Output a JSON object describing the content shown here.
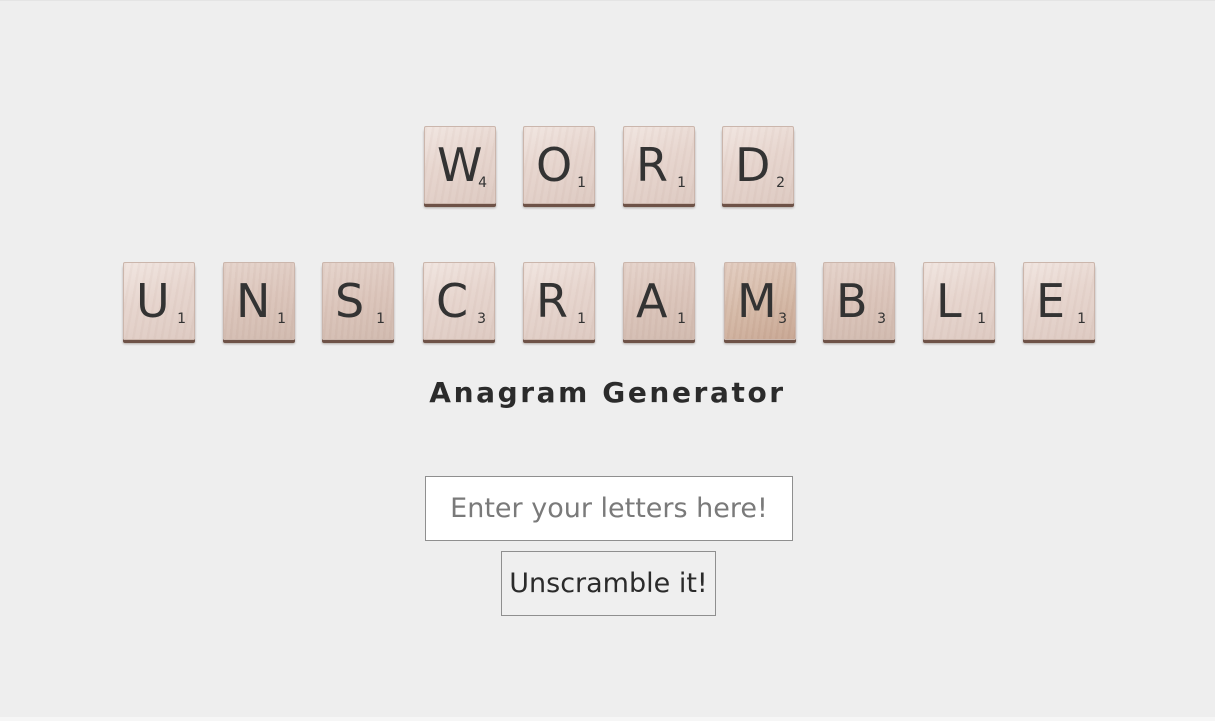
{
  "logo": {
    "row_word": {
      "tiles": [
        {
          "letter": "W",
          "score": "4"
        },
        {
          "letter": "O",
          "score": "1"
        },
        {
          "letter": "R",
          "score": "1"
        },
        {
          "letter": "D",
          "score": "2"
        }
      ]
    },
    "row_unscramble": {
      "tiles": [
        {
          "letter": "U",
          "score": "1"
        },
        {
          "letter": "N",
          "score": "1"
        },
        {
          "letter": "S",
          "score": "1"
        },
        {
          "letter": "C",
          "score": "3"
        },
        {
          "letter": "R",
          "score": "1"
        },
        {
          "letter": "A",
          "score": "1"
        },
        {
          "letter": "M",
          "score": "3"
        },
        {
          "letter": "B",
          "score": "3"
        },
        {
          "letter": "L",
          "score": "1"
        },
        {
          "letter": "E",
          "score": "1"
        }
      ]
    }
  },
  "subtitle": "Anagram Generator",
  "search": {
    "value": "",
    "placeholder": "Enter your letters here!"
  },
  "unscramble_button": {
    "label": "Unscramble it!"
  },
  "colors": {
    "page_background": "#eeeeee",
    "text": "#333333",
    "tile_face": "#e7d6cf",
    "tile_edge": "#6e5247"
  }
}
